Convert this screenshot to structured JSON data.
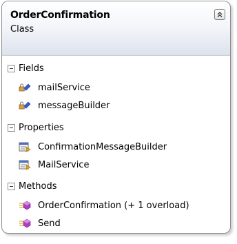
{
  "class": {
    "name": "OrderConfirmation",
    "kind": "Class"
  },
  "sections": {
    "fields": {
      "title": "Fields",
      "items": [
        "mailService",
        "messageBuilder"
      ]
    },
    "properties": {
      "title": "Properties",
      "items": [
        "ConfirmationMessageBuilder",
        "MailService"
      ]
    },
    "methods": {
      "title": "Methods",
      "items": [
        "OrderConfirmation (+ 1 overload)",
        "Send"
      ]
    }
  },
  "icons": {
    "collapse": "double-chevron-up-icon",
    "field": "field-lock-icon",
    "property": "property-icon",
    "method": "method-icon"
  }
}
